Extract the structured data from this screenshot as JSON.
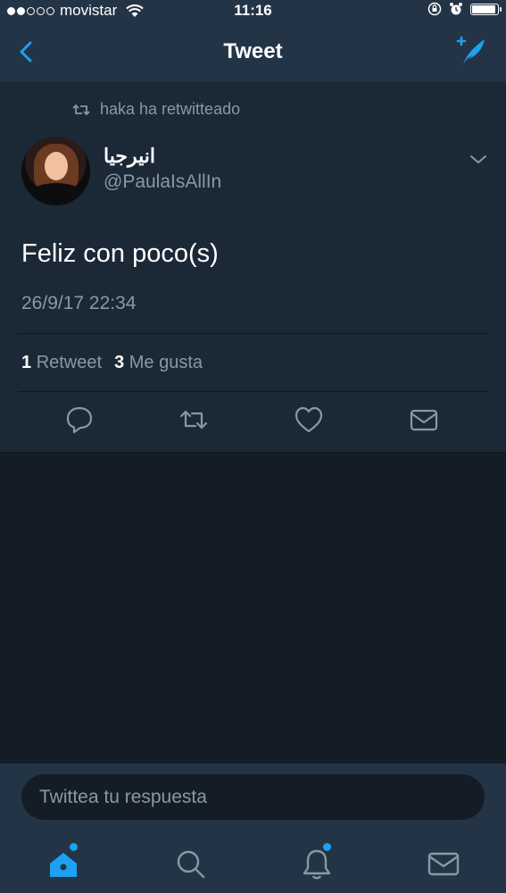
{
  "status_bar": {
    "carrier": "movistar",
    "time": "11:16",
    "signal_bars_filled": 2,
    "signal_bars_total": 5,
    "battery_level": 0.85
  },
  "nav": {
    "title": "Tweet",
    "back_icon": "chevron-left-icon",
    "compose_icon": "compose-tweet-icon"
  },
  "tweet": {
    "retweet_context": "haka ha retwitteado",
    "author_name": "انيرجيا",
    "author_handle": "@PaulaIsAllIn",
    "text": "Feliz con poco(s)",
    "timestamp": "26/9/17 22:34",
    "retweet_count": "1",
    "retweet_label": "Retweet",
    "like_count": "3",
    "like_label": "Me gusta"
  },
  "reply": {
    "placeholder": "Twittea tu respuesta"
  },
  "tabs": [
    {
      "icon": "home-icon",
      "active": true,
      "badge": true
    },
    {
      "icon": "search-icon",
      "active": false,
      "badge": false
    },
    {
      "icon": "bell-icon",
      "active": false,
      "badge": true
    },
    {
      "icon": "mail-icon",
      "active": false,
      "badge": false
    }
  ],
  "colors": {
    "accent": "#1da1f2",
    "background": "#141d26",
    "card": "#1b2836",
    "bars": "#243447",
    "secondary_text": "#8899a6"
  }
}
